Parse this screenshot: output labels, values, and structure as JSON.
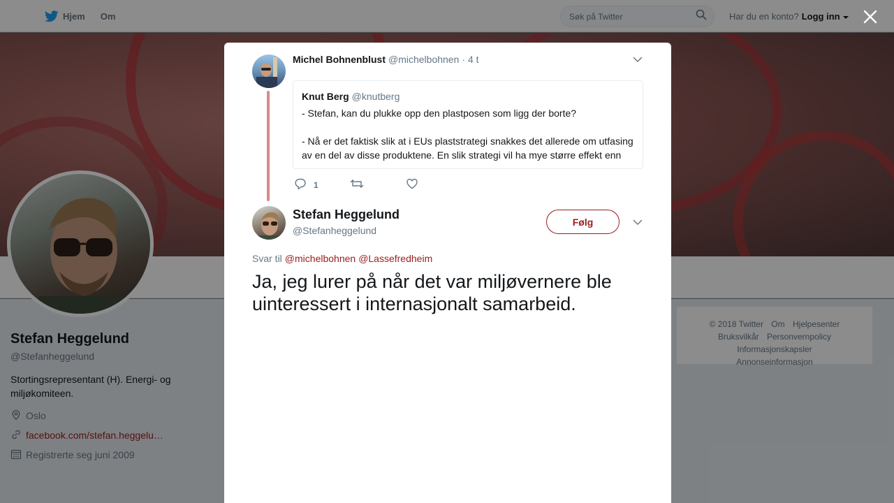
{
  "topbar": {
    "home_label": "Hjem",
    "about_label": "Om",
    "search_placeholder": "Søk på Twitter",
    "login_prompt": "Har du en konto?",
    "login_label": "Logg inn"
  },
  "profile": {
    "name": "Stefan Heggelund",
    "handle": "@Stefanheggelund",
    "bio": "Stortingsrepresentant (H). Energi- og miljøkomiteen.",
    "location": "Oslo",
    "link": "facebook.com/stefan.heggelu…",
    "joined": "Registrerte seg juni 2009"
  },
  "footer": {
    "items": [
      "© 2018 Twitter",
      "Om",
      "Hjelpesenter",
      "Bruksvilkår",
      "Personvernpolicy",
      "Informasjonskapsler",
      "Annonseinformasjon"
    ]
  },
  "context_tweet": {
    "name": "Michel Bohnenblust",
    "handle": "@michelbohnen",
    "time": "· 4 t",
    "quote": {
      "name": "Knut Berg",
      "handle": "@knutberg",
      "text": "- Stefan, kan du plukke opp den plastposen som ligg der borte?\n\n- Nå er det faktisk slik at i EUs plaststrategi snakkes det allerede om utfasing av en del av disse produktene. En slik strategi vil ha mye større effekt enn"
    },
    "reply_count": "1"
  },
  "main_tweet": {
    "name": "Stefan Heggelund",
    "handle": "@Stefanheggelund",
    "follow_label": "Følg",
    "reply_prefix": "Svar til",
    "reply_mentions": [
      "@michelbohnen",
      "@Lassefredheim"
    ],
    "text": "Ja, jeg lurer på når det var miljøvernere ble uinteressert i internasjonalt samarbeid."
  },
  "colors": {
    "accent": "#9b1c1c",
    "twitter_blue": "#1da1f2",
    "muted": "#657786"
  }
}
